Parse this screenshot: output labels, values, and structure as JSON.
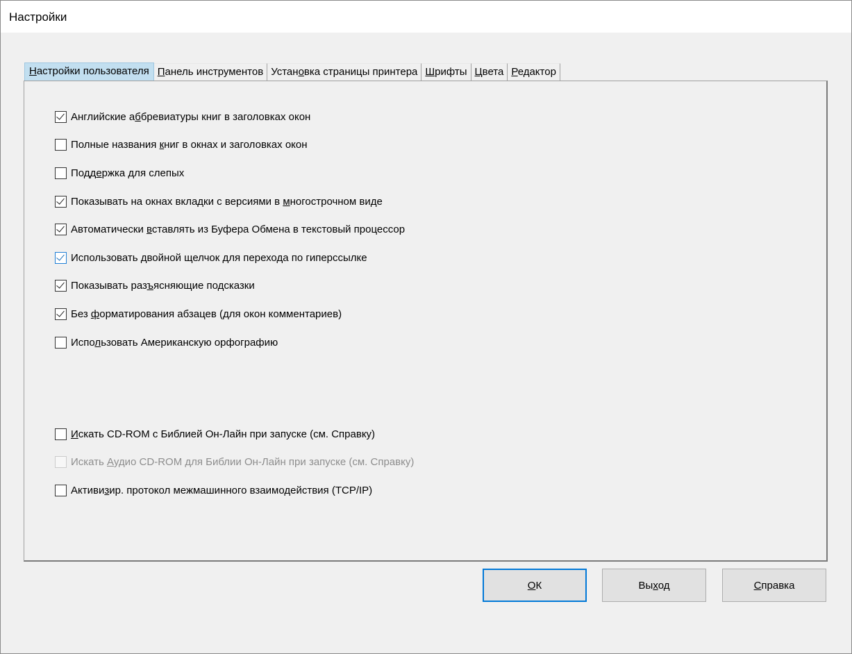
{
  "window": {
    "title": "Настройки"
  },
  "tabs": [
    {
      "pre": "",
      "ul": "Н",
      "post": "астройки пользователя",
      "active": true
    },
    {
      "pre": "",
      "ul": "П",
      "post": "анель инструментов",
      "active": false
    },
    {
      "pre": "Устан",
      "ul": "о",
      "post": "вка страницы принтера",
      "active": false
    },
    {
      "pre": "",
      "ul": "Ш",
      "post": "рифты",
      "active": false
    },
    {
      "pre": "",
      "ul": "Ц",
      "post": "вета",
      "active": false
    },
    {
      "pre": "",
      "ul": "Р",
      "post": "едактор",
      "active": false
    }
  ],
  "options": [
    {
      "pre": "Английские а",
      "ul": "б",
      "post": "бревиатуры книг в заголовках окон",
      "checked": true,
      "disabled": false
    },
    {
      "pre": "Полные названия ",
      "ul": "к",
      "post": "ниг в окнах и заголовках окон",
      "checked": false,
      "disabled": false
    },
    {
      "pre": "Подд",
      "ul": "е",
      "post": "ржка для слепых",
      "checked": false,
      "disabled": false
    },
    {
      "pre": "Показывать на окнах вкладки с версиями в ",
      "ul": "м",
      "post": "ногострочном виде",
      "checked": true,
      "disabled": false
    },
    {
      "pre": "Автоматически ",
      "ul": "в",
      "post": "ставлять из Буфера Обмена в текстовый процессор",
      "checked": true,
      "disabled": false
    },
    {
      "pre": "Использовать ",
      "ul": "д",
      "post": "войной щелчок для перехода по гиперссылке",
      "checked": true,
      "disabled": false,
      "focused": true
    },
    {
      "pre": "Показывать раз",
      "ul": "ъ",
      "post": "ясняющие подсказки",
      "checked": true,
      "disabled": false
    },
    {
      "pre": "Без ",
      "ul": "ф",
      "post": "орматирования абзацев (для окон комментариев)",
      "checked": true,
      "disabled": false
    },
    {
      "pre": "Испо",
      "ul": "л",
      "post": "ьзовать Американскую орфографию",
      "checked": false,
      "disabled": false
    },
    {
      "pre": "",
      "ul": "И",
      "post": "скать CD-ROM с Библией Он-Лайн при запуске (см. Справку)",
      "checked": false,
      "disabled": false
    },
    {
      "pre": "Искать ",
      "ul": "А",
      "post": "удио CD-ROM для Библии Он-Лайн при запуске (см. Справку)",
      "checked": false,
      "disabled": true
    },
    {
      "pre": "Активи",
      "ul": "з",
      "post": "ир. протокол межмашинного взаимодействия (TCP/IP)",
      "checked": false,
      "disabled": false
    }
  ],
  "buttons": {
    "ok": {
      "pre": "",
      "ul": "О",
      "post": "К"
    },
    "exit": {
      "pre": "Вы",
      "ul": "х",
      "post": "од"
    },
    "help": {
      "pre": "",
      "ul": "С",
      "post": "правка"
    }
  }
}
